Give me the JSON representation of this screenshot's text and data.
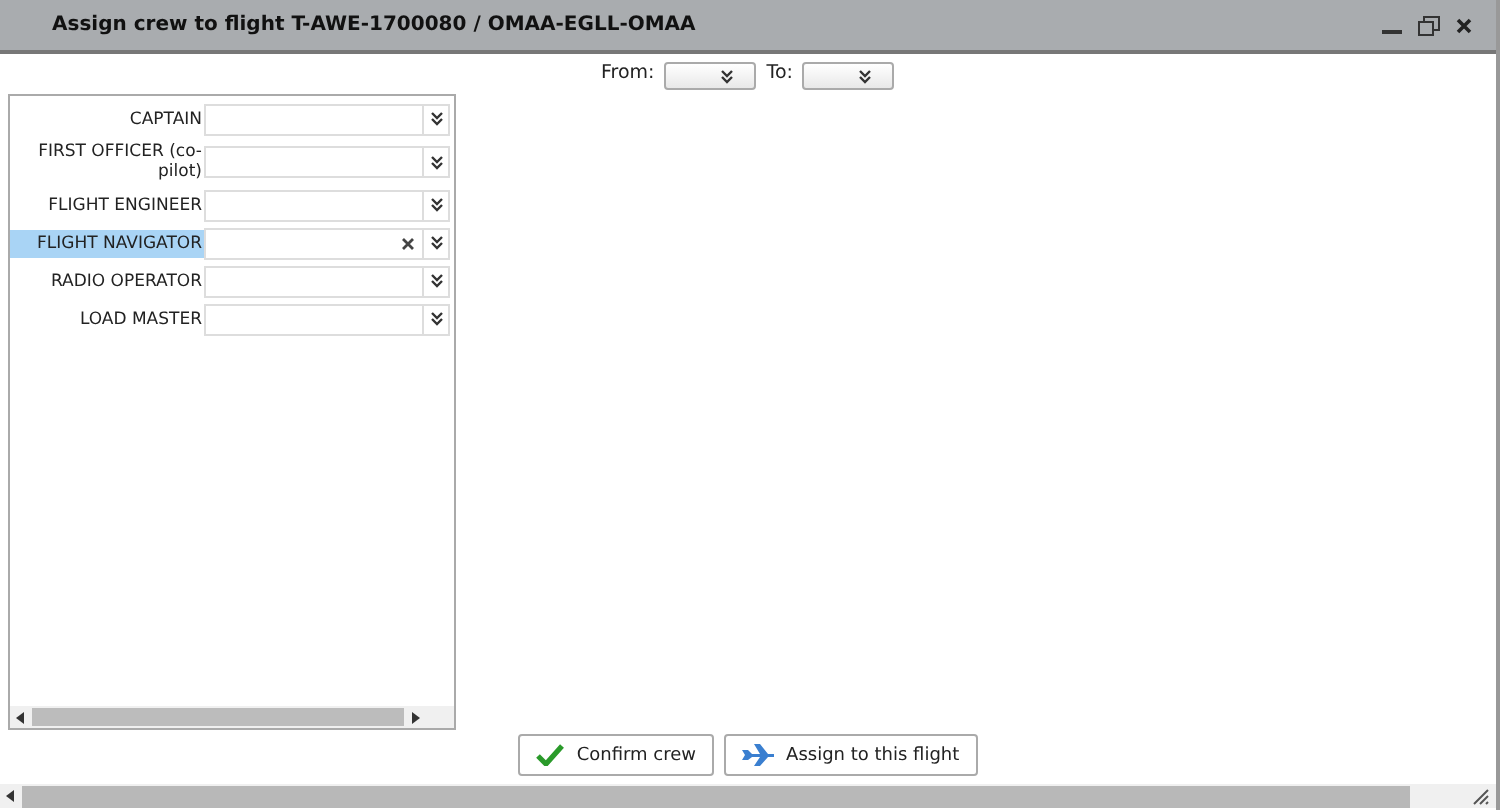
{
  "window": {
    "title": "Assign crew to flight T-AWE-1700080 / OMAA-EGLL-OMAA"
  },
  "filters": [
    {
      "label": "From:"
    },
    {
      "label": "To:"
    }
  ],
  "roles": [
    {
      "label": "CAPTAIN",
      "selected": false
    },
    {
      "label": "FIRST OFFICER (co-pilot)",
      "selected": false
    },
    {
      "label": "FLIGHT ENGINEER",
      "selected": false
    },
    {
      "label": "FLIGHT NAVIGATOR",
      "selected": true
    },
    {
      "label": "RADIO OPERATOR",
      "selected": false
    },
    {
      "label": "LOAD MASTER",
      "selected": false
    }
  ],
  "buttons": [
    {
      "label": "Confirm crew",
      "kind": "confirm"
    },
    {
      "label": "Assign to this flight",
      "kind": "assign"
    }
  ]
}
